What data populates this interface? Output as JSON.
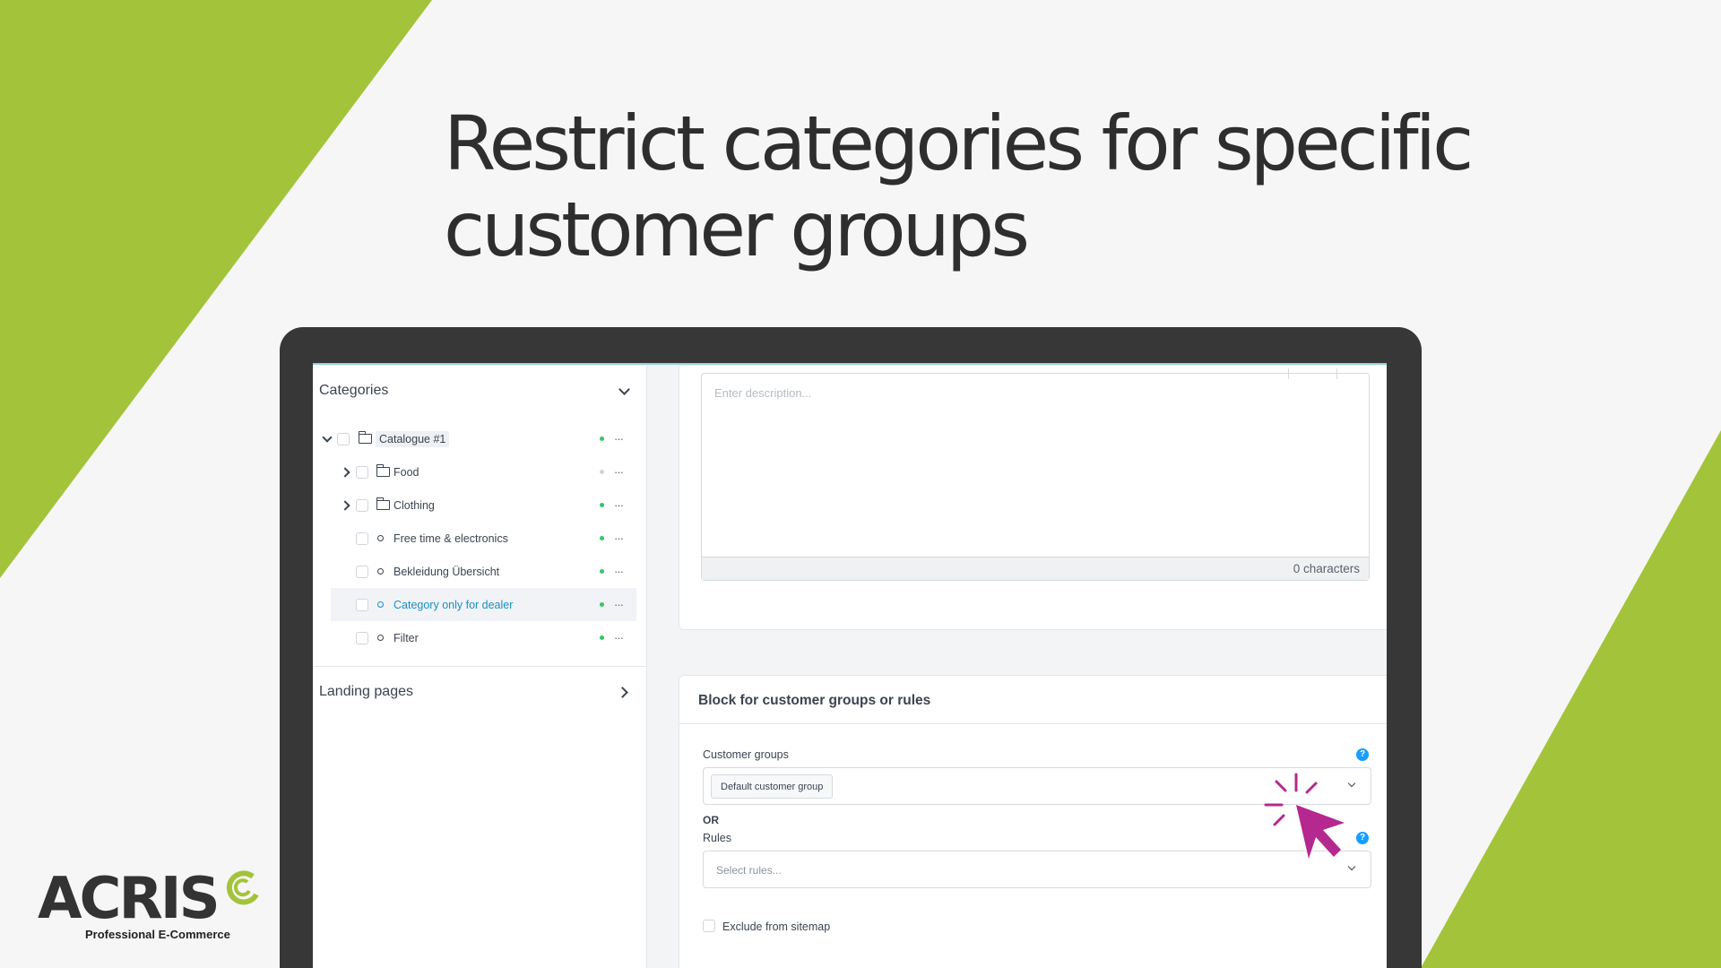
{
  "headline": {
    "line1": "Restrict categories for specific",
    "line2": "customer groups"
  },
  "colors": {
    "accent_green": "#a3c43a",
    "cursor_magenta": "#b5288f",
    "help_blue": "#189eff",
    "status_green": "#37c46a"
  },
  "sidebar": {
    "categories_title": "Categories",
    "tree": [
      {
        "label": "Catalogue #1",
        "level": 0,
        "expand": "down",
        "icon": "folder-open-icon",
        "status": "active"
      },
      {
        "label": "Food",
        "level": 1,
        "expand": "right",
        "icon": "folder-icon",
        "status": "inactive"
      },
      {
        "label": "Clothing",
        "level": 1,
        "expand": "right",
        "icon": "folder-icon",
        "status": "active"
      },
      {
        "label": "Free time & electronics",
        "level": 1,
        "expand": "none",
        "icon": "circle-icon",
        "status": "active"
      },
      {
        "label": "Bekleidung Übersicht",
        "level": 1,
        "expand": "none",
        "icon": "circle-icon",
        "status": "active"
      },
      {
        "label": "Category only for dealer",
        "level": 1,
        "expand": "none",
        "icon": "circle-icon",
        "status": "active",
        "selected": true
      },
      {
        "label": "Filter",
        "level": 1,
        "expand": "none",
        "icon": "circle-icon",
        "status": "active"
      }
    ],
    "more_label": "···",
    "landing_pages_title": "Landing pages"
  },
  "description": {
    "placeholder": "Enter description...",
    "char_count": "0 characters"
  },
  "block_card": {
    "title": "Block for customer groups or rules",
    "customer_groups_label": "Customer groups",
    "customer_groups_chip": "Default customer group",
    "or_label": "OR",
    "rules_label": "Rules",
    "rules_placeholder": "Select rules...",
    "help_glyph": "?",
    "exclude_sitemap_label": "Exclude from sitemap"
  },
  "logo": {
    "brand": "ACRIS",
    "tagline": "Professional E-Commerce"
  }
}
